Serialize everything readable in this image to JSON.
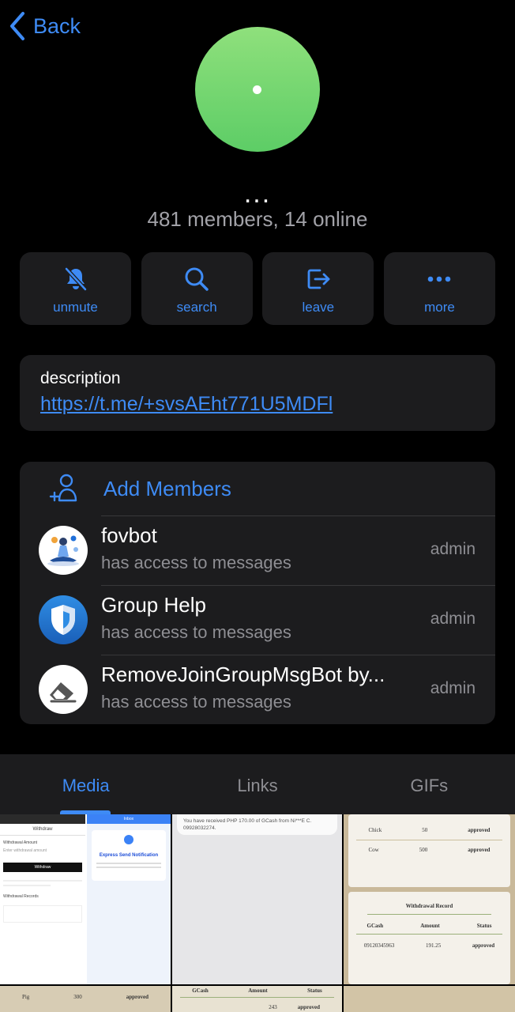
{
  "nav": {
    "back_label": "Back"
  },
  "group": {
    "name": "...",
    "subtitle": "481 members, 14 online",
    "avatar_color": "#6fd46e"
  },
  "actions": [
    {
      "label": "unmute",
      "icon": "bell-slash-icon"
    },
    {
      "label": "search",
      "icon": "search-icon"
    },
    {
      "label": "leave",
      "icon": "leave-icon"
    },
    {
      "label": "more",
      "icon": "more-dots-icon"
    }
  ],
  "description": {
    "title": "description",
    "link": "https://t.me/+svsAEht771U5MDFl"
  },
  "members": {
    "add_label": "Add Members",
    "items": [
      {
        "name": "fovbot",
        "status": "has access to messages",
        "role": "admin",
        "icon": "bot-avatar-meditation"
      },
      {
        "name": "Group Help",
        "status": "has access to messages",
        "role": "admin",
        "icon": "shield-avatar"
      },
      {
        "name": "RemoveJoinGroupMsgBot by...",
        "status": "has access to messages",
        "role": "admin",
        "icon": "eraser-avatar"
      }
    ]
  },
  "tabs": [
    {
      "label": "Media",
      "active": true
    },
    {
      "label": "Links",
      "active": false
    },
    {
      "label": "GIFs",
      "active": false
    }
  ],
  "media": {
    "thumb1": {
      "left_title": "Withdraw",
      "left_field": "Withdrawal Amount",
      "left_placeholder": "Enter withdrawal amount",
      "left_button": "Withdraw",
      "left_section": "Withdrawal Records",
      "right_header": "Inbox",
      "right_title": "Express Send Notification"
    },
    "thumb2": {
      "text": "You have received PHP 170.00 of GCash from Ni***E C. 09928032274."
    },
    "thumb3": {
      "top_rows": [
        [
          "Chick",
          "50",
          "approved"
        ],
        [
          "Cow",
          "500",
          "approved"
        ]
      ],
      "record_title": "Withdrawal Record",
      "headers": [
        "GCash",
        "Amount",
        "Status"
      ],
      "row": [
        "09120345963",
        "191.25",
        "approved"
      ]
    },
    "thumb4": {
      "row": [
        "Pig",
        "300",
        "approved"
      ]
    },
    "thumb5": {
      "headers": [
        "GCash",
        "Amount",
        "Status"
      ],
      "row": [
        "243",
        "approved"
      ]
    }
  },
  "colors": {
    "accent": "#3e8bf5",
    "card": "#1c1c1e",
    "secondary_text": "#8e8e93"
  }
}
